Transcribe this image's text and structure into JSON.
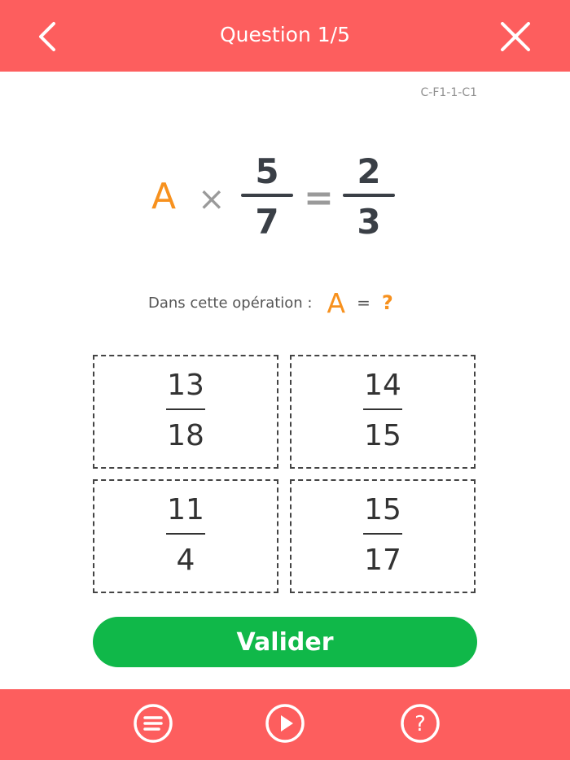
{
  "header": {
    "title": "Question 1/5",
    "back_icon": "chevron-left-icon",
    "close_icon": "close-icon",
    "color": "#fd5e5e"
  },
  "exercise_code": "C-F1-1-C1",
  "equation": {
    "unknown": "A",
    "operator": "×",
    "fraction": {
      "numerator": "5",
      "denominator": "7"
    },
    "equals": "=",
    "result": {
      "numerator": "2",
      "denominator": "3"
    }
  },
  "prompt": {
    "label": "Dans cette opération :",
    "unknown": "A",
    "equals": "=",
    "question_mark": "?"
  },
  "options": [
    {
      "numerator": "13",
      "denominator": "18"
    },
    {
      "numerator": "14",
      "denominator": "15"
    },
    {
      "numerator": "11",
      "denominator": "4"
    },
    {
      "numerator": "15",
      "denominator": "17"
    }
  ],
  "validate_label": "Valider",
  "validate_color": "#10b849",
  "accent_color": "#f7911e",
  "footer": {
    "icons": [
      "list-icon",
      "play-icon",
      "help-icon"
    ]
  }
}
